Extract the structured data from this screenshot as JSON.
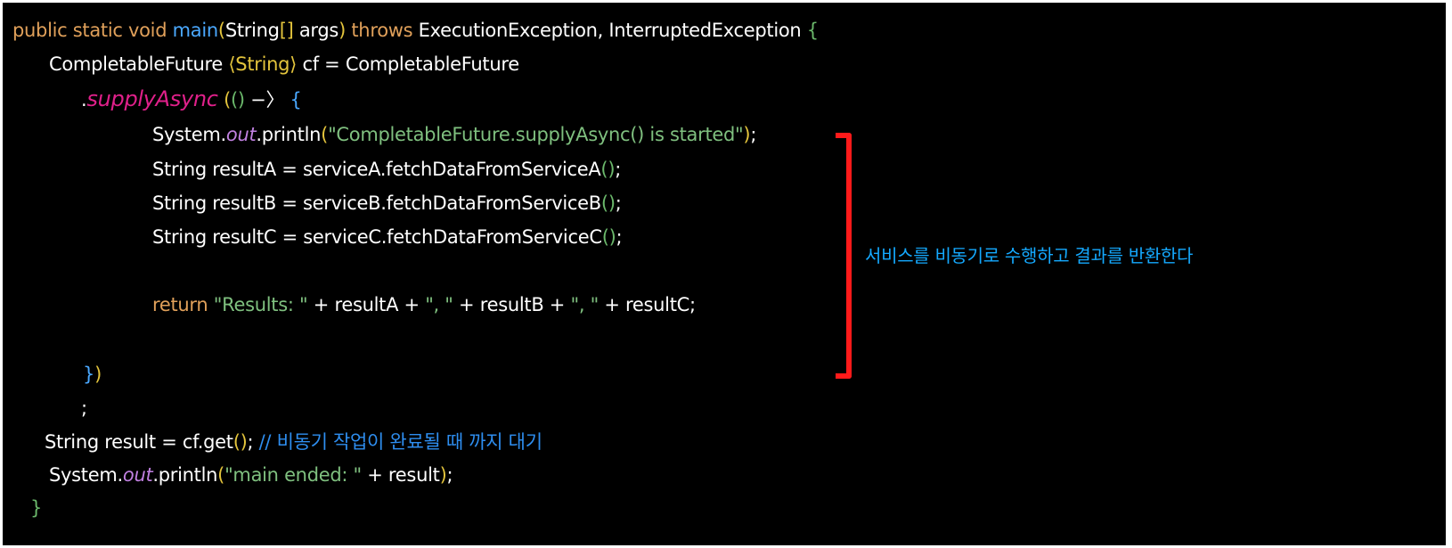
{
  "colors": {
    "background": "#000000",
    "keyword": "#e0a05a",
    "method": "#4aa8ff",
    "string": "#7fc07f",
    "static_field": "#c080e0",
    "supply_async": "#e0208a",
    "comment": "#2e8ef0",
    "annotation_text": "#14a9ff",
    "annotation_bracket": "#ff1a1a"
  },
  "code": {
    "l1": {
      "kw1": "public static void",
      "name": "main",
      "p_open": "(",
      "type": "String",
      "arr": "[]",
      "param": " args",
      "p_close": ")",
      "kw2": "throws",
      "exceptions": " ExecutionException, InterruptedException ",
      "brace": "{"
    },
    "l2": {
      "decl": "CompletableFuture ",
      "generic": "⟨String⟩",
      "rest": " cf = CompletableFuture"
    },
    "l3": {
      "dot": ".",
      "method": "supplyAsync",
      "p1": "(",
      "p2": "()",
      "arrow": " −〉",
      "brace": "{"
    },
    "l4": {
      "obj": "System.",
      "field": "out",
      "call": ".println",
      "p1": "(",
      "str": "\"CompletableFuture.supplyAsync() is started\"",
      "p2": ")",
      "semi": ";"
    },
    "l5": {
      "text": "String resultA = serviceA.fetchDataFromServiceA",
      "parens": "()",
      "semi": ";"
    },
    "l6": {
      "text": "String resultB = serviceB.fetchDataFromServiceB",
      "parens": "()",
      "semi": ";"
    },
    "l7": {
      "text": "String resultC = serviceC.fetchDataFromServiceC",
      "parens": "()",
      "semi": ";"
    },
    "l8": {
      "kw": "return",
      "s1": " \"Results: \"",
      "t1": " + resultA + ",
      "s2": "\", \"",
      "t2": " + resultB + ",
      "s3": "\", \"",
      "t3": " + resultC;"
    },
    "l9": {
      "b1": "}",
      "b2": ")"
    },
    "l10": {
      "semi": ";"
    },
    "l11": {
      "text": "String result = cf.get",
      "parens": "()",
      "semi": ";",
      "comment": " // 비동기 작업이 완료될 때 까지 대기"
    },
    "l12": {
      "obj": "System.",
      "field": "out",
      "call": ".println",
      "p1": "(",
      "str": "\"main ended: \"",
      "rest": " + result",
      "p2": ")",
      "semi": ";"
    },
    "l13": {
      "brace": "}"
    }
  },
  "annotation": {
    "text": "서비스를 비동기로 수행하고 결과를 반환한다"
  }
}
